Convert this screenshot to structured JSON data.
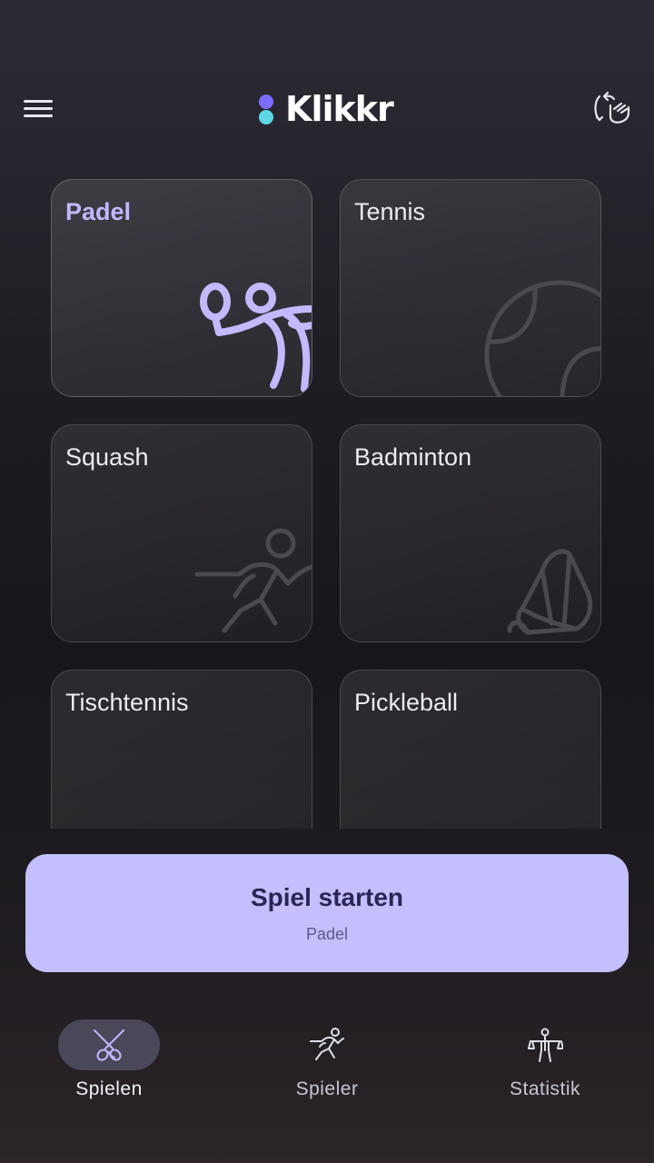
{
  "app": {
    "name": "Klikkr",
    "logo_colors": [
      "#7b6cff",
      "#5ed7e8"
    ]
  },
  "header": {
    "menu_icon": "hamburger-icon",
    "flip_icon": "rotate-device-icon"
  },
  "sports": [
    {
      "label": "Padel",
      "icon": "padel-player-icon",
      "selected": true
    },
    {
      "label": "Tennis",
      "icon": "tennis-ball-icon",
      "selected": false
    },
    {
      "label": "Squash",
      "icon": "squash-player-icon",
      "selected": false
    },
    {
      "label": "Badminton",
      "icon": "shuttlecock-icon",
      "selected": false
    },
    {
      "label": "Tischtennis",
      "icon": "table-tennis-ball-icon",
      "selected": false
    },
    {
      "label": "Pickleball",
      "icon": "pickleball-icon",
      "selected": false
    }
  ],
  "start_button": {
    "title": "Spiel starten",
    "subtitle": "Padel"
  },
  "nav": {
    "items": [
      {
        "label": "Spielen",
        "icon": "crossed-rackets-icon",
        "active": true
      },
      {
        "label": "Spieler",
        "icon": "running-player-icon",
        "active": false
      },
      {
        "label": "Statistik",
        "icon": "person-balance-icon",
        "active": false
      }
    ]
  },
  "colors": {
    "accent": "#c4bfff",
    "accent_text": "#2a2654",
    "selected_label": "#c2b8ff"
  }
}
